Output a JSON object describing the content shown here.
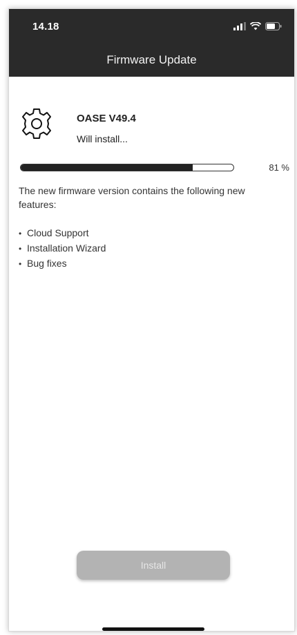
{
  "status_bar": {
    "time": "14.18",
    "icons": [
      "signal-icon",
      "wifi-icon",
      "battery-icon"
    ]
  },
  "header": {
    "title": "Firmware Update"
  },
  "firmware": {
    "icon": "gear-icon",
    "name": "OASE V49.4",
    "status": "Will install...",
    "progress": 0.81,
    "progress_label": "81 %"
  },
  "description": "The new firmware version contains the following new features:",
  "features": [
    "Cloud Support",
    "Installation Wizard",
    "Bug fixes"
  ],
  "actions": {
    "install_label": "Install"
  },
  "colors": {
    "header_bg": "#2a2a2a",
    "progress_fill": "#222222",
    "button_disabled": "#b3b3b3"
  }
}
